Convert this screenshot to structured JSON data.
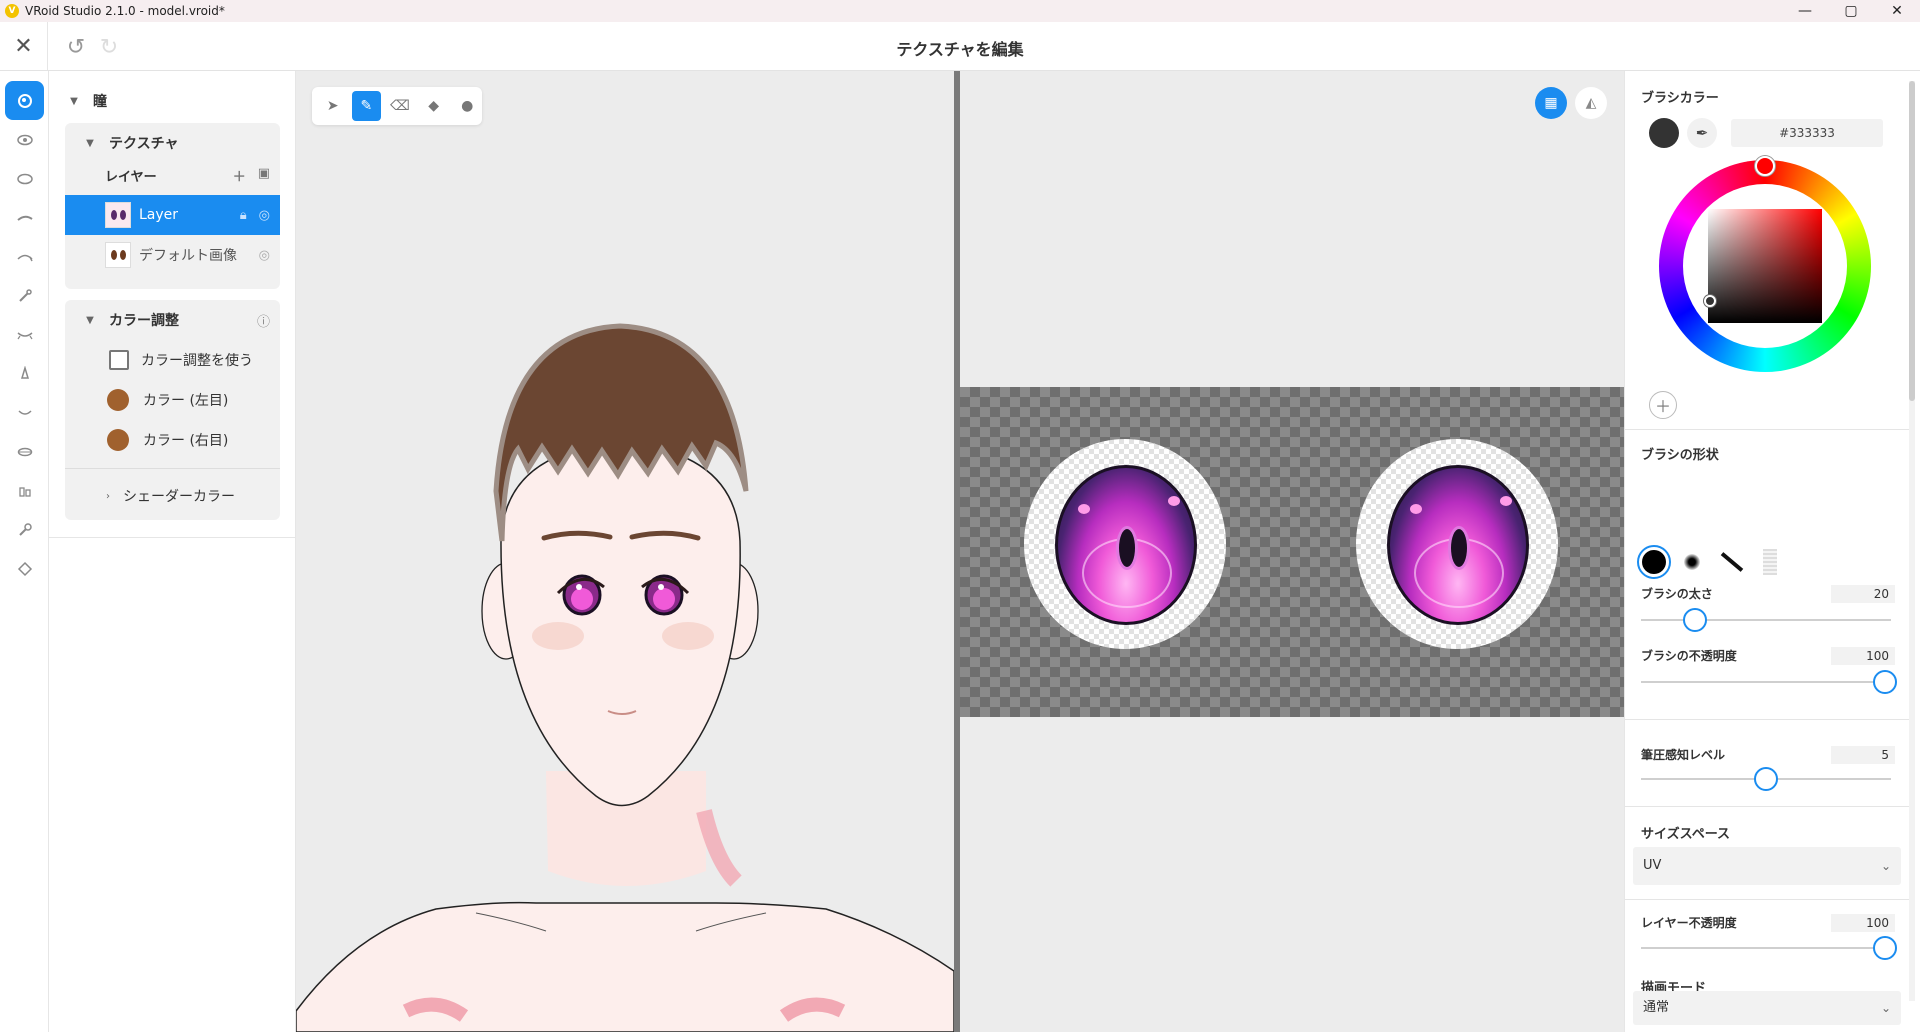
{
  "window": {
    "title": "VRoid Studio 2.1.0 - model.vroid*",
    "controls": [
      "—",
      "▢",
      "✕"
    ]
  },
  "toolbar": {
    "page_title": "テクスチャを編集",
    "close_icon": "close-icon",
    "undo_icon": "undo-icon",
    "redo_icon": "redo-icon"
  },
  "nav": {
    "items": [
      "eye-target-icon",
      "eye-icon",
      "ellipse-icon",
      "eyebrow-icon",
      "eyelash-icon",
      "brush-icon",
      "eyelid-icon",
      "nose-icon",
      "mouth-icon",
      "lips-icon",
      "teeth-icon",
      "wrench-icon",
      "face-outline-icon"
    ],
    "active_index": 0
  },
  "side": {
    "section_title": "瞳",
    "texture": {
      "title": "テクスチャ",
      "layer_header": "レイヤー",
      "layers": [
        {
          "name": "Layer",
          "selected": true
        },
        {
          "name": "デフォルト画像",
          "selected": false
        }
      ]
    },
    "color_adjust": {
      "title": "カラー調整",
      "use_label": "カラー調整を使う",
      "left_label": "カラー (左目)",
      "right_label": "カラー (右目)",
      "left_color": "#a0612e",
      "right_color": "#a0612e",
      "shader_label": "シェーダーカラー"
    }
  },
  "draw_tools": {
    "items": [
      "cursor-icon",
      "pen-icon",
      "eraser-icon",
      "fill-icon",
      "blur-icon"
    ],
    "active_index": 1
  },
  "uv": {
    "grid_button": "grid-icon",
    "mirror_button": "mirror-icon"
  },
  "brush": {
    "color_label": "ブラシカラー",
    "color_hex": "#333333",
    "shape_label": "ブラシの形状",
    "size_label": "ブラシの太さ",
    "size_value": "20",
    "size_max": 100,
    "opacity_label": "ブラシの不透明度",
    "opacity_value": "100",
    "opacity_max": 100,
    "pressure_label": "筆圧感知レベル",
    "pressure_value": "5",
    "pressure_max": 10,
    "size_space_label": "サイズスペース",
    "size_space_value": "UV",
    "layer_opacity_label": "レイヤー不透明度",
    "layer_opacity_value": "100",
    "draw_mode_label": "描画モード",
    "draw_mode_value": "通常"
  },
  "colors": {
    "accent": "#1a8cf0",
    "eye_color": "#f05ad8",
    "hair_color": "#6b4632"
  }
}
